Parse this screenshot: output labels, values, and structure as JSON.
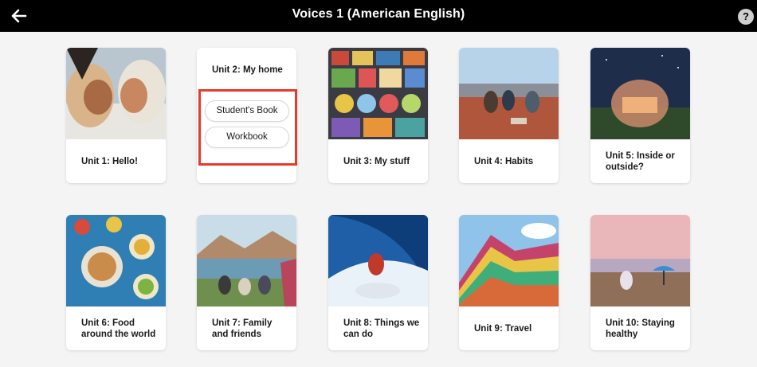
{
  "header": {
    "title": "Voices 1 (American English)",
    "help_label": "?"
  },
  "units": [
    {
      "label": "Unit 1: Hello!",
      "image": "two-people-smiling"
    },
    {
      "label": "Unit 2: My home",
      "expanded": true,
      "options": [
        "Student's Book",
        "Workbook"
      ]
    },
    {
      "label": "Unit 3: My stuff",
      "image": "colorful-objects-collection"
    },
    {
      "label": "Unit 4: Habits",
      "image": "people-sitting-on-rooftop"
    },
    {
      "label": "Unit 5: Inside or outside?",
      "image": "glass-dome-at-night"
    },
    {
      "label": "Unit 6: Food around the world",
      "image": "table-of-food"
    },
    {
      "label": "Unit 7: Family and friends",
      "image": "family-picnic-by-lake"
    },
    {
      "label": "Unit 8: Things we can do",
      "image": "surfer-on-wave"
    },
    {
      "label": "Unit 9: Travel",
      "image": "rainbow-mountains"
    },
    {
      "label": "Unit 10: Staying healthy",
      "image": "person-on-beach"
    }
  ],
  "colors": {
    "topbar": "#000000",
    "background": "#f4f4f4",
    "highlight": "#e53a2c"
  }
}
